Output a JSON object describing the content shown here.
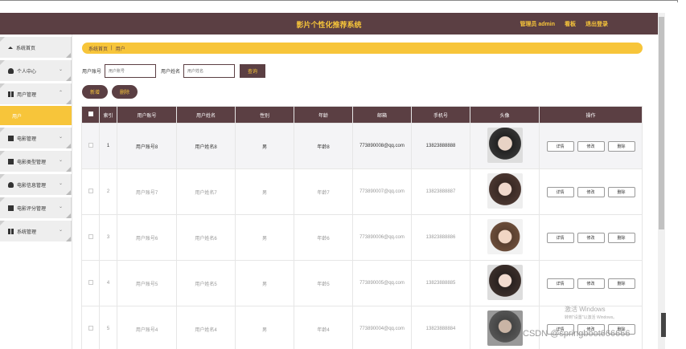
{
  "header": {
    "title": "影片个性化推荐系统",
    "admin": "管理员 admin",
    "board": "看板",
    "logout": "退出登录"
  },
  "sidebar": {
    "items": [
      {
        "label": "系统首页",
        "icon": "home-icon"
      },
      {
        "label": "个人中心",
        "icon": "person-icon"
      },
      {
        "label": "用户管理",
        "icon": "grid-icon",
        "expanded": true,
        "sub": "用户"
      },
      {
        "label": "电影管理",
        "icon": "list-icon"
      },
      {
        "label": "电影类型管理",
        "icon": "folder-icon"
      },
      {
        "label": "电影信息管理",
        "icon": "person-icon"
      },
      {
        "label": "电影评分管理",
        "icon": "monitor-icon"
      },
      {
        "label": "系统管理",
        "icon": "settings-icon"
      }
    ]
  },
  "breadcrumb": {
    "home": "系统首页",
    "sep": "|",
    "current": "用户"
  },
  "search": {
    "account_label": "用户账号",
    "account_placeholder": "用户账号",
    "name_label": "用户姓名",
    "name_placeholder": "用户姓名",
    "button": "查询"
  },
  "actions": {
    "add": "新增",
    "delete": "删除"
  },
  "table": {
    "headers": [
      "索引",
      "用户账号",
      "用户姓名",
      "性别",
      "年龄",
      "邮箱",
      "手机号",
      "头像",
      "操作"
    ],
    "rows": [
      {
        "idx": "1",
        "account": "用户账号8",
        "name": "用户姓名8",
        "gender": "男",
        "age": "年龄8",
        "email": "773890008@qq.com",
        "phone": "13823888888"
      },
      {
        "idx": "2",
        "account": "用户账号7",
        "name": "用户姓名7",
        "gender": "男",
        "age": "年龄7",
        "email": "773890007@qq.com",
        "phone": "13823888887"
      },
      {
        "idx": "3",
        "account": "用户账号6",
        "name": "用户姓名6",
        "gender": "男",
        "age": "年龄6",
        "email": "773890006@qq.com",
        "phone": "13823888886"
      },
      {
        "idx": "4",
        "account": "用户账号5",
        "name": "用户姓名5",
        "gender": "男",
        "age": "年龄5",
        "email": "773890005@qq.com",
        "phone": "13823888885"
      },
      {
        "idx": "5",
        "account": "用户账号4",
        "name": "用户姓名4",
        "gender": "男",
        "age": "年龄4",
        "email": "773890004@qq.com",
        "phone": "13823888884"
      }
    ],
    "ops": [
      "详情",
      "修改",
      "删除"
    ]
  },
  "overlay": {
    "activate": "激活 Windows",
    "activate_sub": "转到\"设置\"以激活 Windows。",
    "csdn": "CSDN @springboot666666"
  },
  "colors": {
    "header_bg": "#5b3f43",
    "accent": "#f7c53a"
  }
}
